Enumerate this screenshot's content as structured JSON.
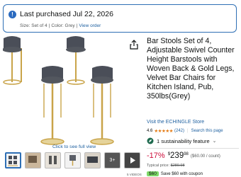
{
  "banner": {
    "icon": "info-icon",
    "title": "Last purchased Jul 22, 2026",
    "size": "Size: Set of 4",
    "color": "Color: Grey",
    "view_order": "View order"
  },
  "product": {
    "title": "Bar Stools Set of 4, Adjustable Swivel Counter Height Barstools with Woven Back & Gold Legs, Velvet Bar Chairs for Kitchen Island, Pub, 350lbs(Grey)",
    "store_link": "Visit the ECHINGLE Store",
    "rating": "4.6",
    "stars": "★★★★★",
    "review_count": "(242)",
    "search_link": "Search this page",
    "sustainability": "1 sustainability feature",
    "discount": "-17%",
    "price_symbol": "$",
    "price_whole": "239",
    "price_fraction": "98",
    "unit_price": "($60.00 / count)",
    "typical_label": "Typical price:",
    "typical_price": "$289.98",
    "coupon_badge": "$60",
    "coupon_text": "Save $60 with coupon"
  },
  "gallery": {
    "see_full_view": "Click to see full view",
    "more_count": "3+",
    "videos_label": "5 VIDEOS"
  },
  "colors": {
    "link": "#2162a1",
    "discount": "#cc0c39",
    "banner_border": "#2e6fb5",
    "stool_seat": "#4a4e58",
    "gold": "#c9a449"
  }
}
